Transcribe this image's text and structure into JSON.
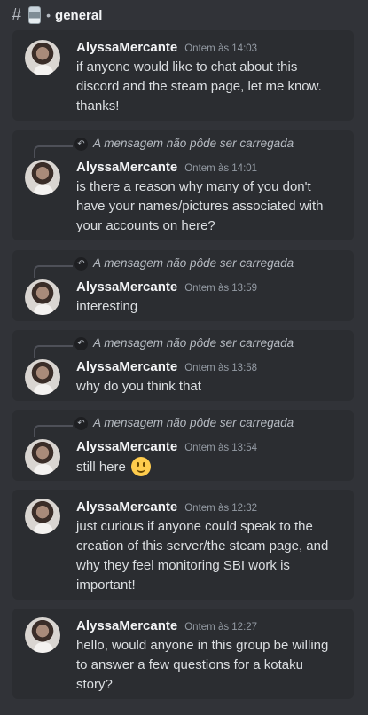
{
  "channel": {
    "hash": "#",
    "separator": "•",
    "name": "general"
  },
  "reply_preview_text": "A mensagem não pôde ser carregada",
  "messages": [
    {
      "author": "AlyssaMercante",
      "timestamp": "Ontem às 14:03",
      "text": "if anyone would like to chat about this discord and the steam page, let me know. thanks!",
      "has_reply": false
    },
    {
      "author": "AlyssaMercante",
      "timestamp": "Ontem às 14:01",
      "text": "is there a reason why many of you don't have your names/pictures associated with your accounts on here?",
      "has_reply": true
    },
    {
      "author": "AlyssaMercante",
      "timestamp": "Ontem às 13:59",
      "text": "interesting",
      "has_reply": true
    },
    {
      "author": "AlyssaMercante",
      "timestamp": "Ontem às 13:58",
      "text": "why do you think that",
      "has_reply": true
    },
    {
      "author": "AlyssaMercante",
      "timestamp": "Ontem às 13:54",
      "text": "still here",
      "emoji": "slightly-smiling-face",
      "has_reply": true
    },
    {
      "author": "AlyssaMercante",
      "timestamp": "Ontem às 12:32",
      "text": "just curious if anyone could speak to the creation of this server/the steam page, and why they feel monitoring SBI work is important!",
      "has_reply": false
    },
    {
      "author": "AlyssaMercante",
      "timestamp": "Ontem às 12:27",
      "text": "hello, would anyone in this group be willing to answer a few questions for a kotaku story?",
      "has_reply": false
    }
  ]
}
